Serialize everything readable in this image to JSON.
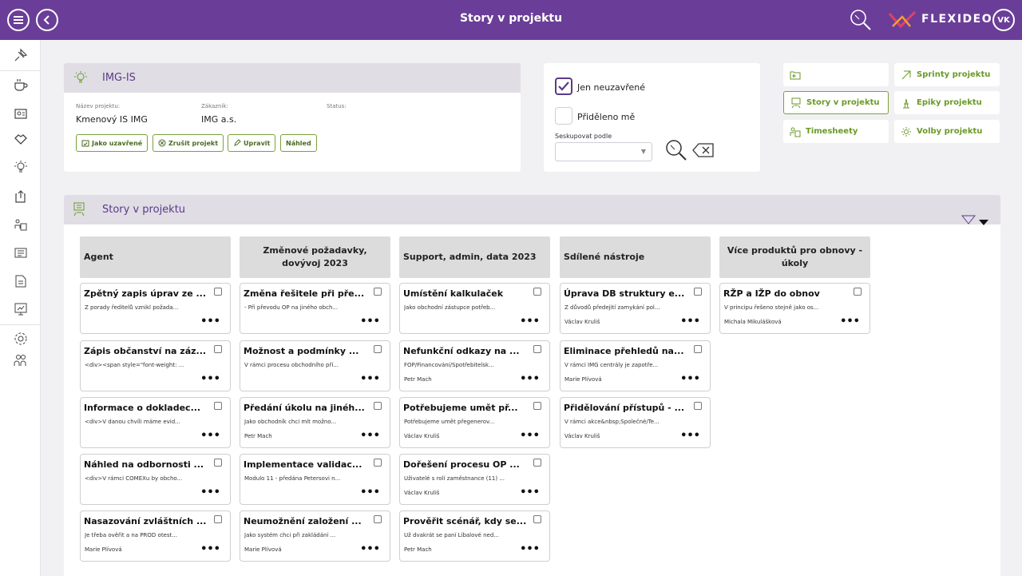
{
  "app": {
    "title": "Story v projektu",
    "brand": "FLEXIDEO",
    "user_initials": "VK"
  },
  "project": {
    "name": "IMG-IS",
    "fields": [
      {
        "label": "Název projektu:",
        "value": "Kmenový IS IMG"
      },
      {
        "label": "Zákazník:",
        "value": "IMG a.s."
      },
      {
        "label": "Status:",
        "value": ""
      }
    ],
    "actions": [
      "Jako uzavřené",
      "Zrušit projekt",
      "Upravit",
      "Náhled"
    ]
  },
  "filters": {
    "only_open": {
      "label": "Jen neuzavřené",
      "checked": true
    },
    "assigned_to_me": {
      "label": "Přiděleno mě",
      "checked": false
    },
    "group_by": {
      "label": "Seskupovat podle",
      "value": ""
    }
  },
  "nav": {
    "sprints": "Sprinty projektu",
    "stories": "Story v projektu",
    "epics": "Epiky projektu",
    "timesheets": "Timesheety",
    "options": "Volby projektu"
  },
  "board": {
    "title": "Story v projektu",
    "columns": [
      {
        "title": "Agent",
        "cards": [
          {
            "title": "Zpětný zapis úprav ze ...",
            "desc": "Z porady ředitelů vznikl požada...",
            "assignee": ""
          },
          {
            "title": "Zápis občanství na záz...",
            "desc": "<div><span style=\"font-weight: ...",
            "assignee": ""
          },
          {
            "title": "Informace o dokladec...",
            "desc": "<div>V danou chvíli máme evid...",
            "assignee": ""
          },
          {
            "title": "Náhled na odbornosti ...",
            "desc": "<div>V rámci COMEXu by obcho...",
            "assignee": ""
          },
          {
            "title": "Nasazování zvláštních ...",
            "desc": "Je třeba ověřit a na PROD otest...",
            "assignee": "Marie Plívová"
          }
        ]
      },
      {
        "title": "Změnové požadavky, dovývoj 2023",
        "cards": [
          {
            "title": "Změna řešitele při pře...",
            "desc": "- Při převodu OP na jiného obch...",
            "assignee": ""
          },
          {
            "title": "Možnost a podmínky ...",
            "desc": "V rámci procesu obchodního pří...",
            "assignee": ""
          },
          {
            "title": "Předání úkolu na jinéh...",
            "desc": "Jako obchodník chci mít možno...",
            "assignee": "Petr Mach"
          },
          {
            "title": "Implementace validac...",
            "desc": "Modulo 11 - předána Petersovi n...",
            "assignee": ""
          },
          {
            "title": "Neumožnění založení ...",
            "desc": "Jako systém chci při zakládání ...",
            "assignee": "Marie Plívová"
          }
        ]
      },
      {
        "title": "Support, admin, data 2023",
        "cards": [
          {
            "title": "Umístění kalkulaček",
            "desc": "Jako obchodní zástupce potřeb...",
            "assignee": ""
          },
          {
            "title": "Nefunkční odkazy na ...",
            "desc": "FOP/Financování/Spotřebitelsk...",
            "assignee": "Petr Mach"
          },
          {
            "title": "Potřebujeme umět př...",
            "desc": "Potřebujeme umět přegenerov...",
            "assignee": "Václav Kruliš"
          },
          {
            "title": "Dořešení procesu OP ...",
            "desc": "Uživatelé s rolí zaměstnance (11) ...",
            "assignee": "Václav Kruliš"
          },
          {
            "title": "Prověřit scénář, kdy se...",
            "desc": "Už dvakrát se paní Líbalové ned...",
            "assignee": "Petr Mach"
          }
        ]
      },
      {
        "title": "Sdílené nástroje",
        "cards": [
          {
            "title": "Úprava DB struktury e...",
            "desc": "Z důvodů předejití zamykání pol...",
            "assignee": "Václav Kruliš"
          },
          {
            "title": "Eliminace přehledů na...",
            "desc": "V rámci IMG centrály je zapotře...",
            "assignee": "Marie Plívová"
          },
          {
            "title": "Přidělování přístupů - ...",
            "desc": "V rámci akce&nbsp;Společné/Te...",
            "assignee": "Václav Kruliš"
          }
        ]
      },
      {
        "title": "Více produktů pro obnovy - úkoly",
        "cards": [
          {
            "title": "RŽP a IŽP do obnov",
            "desc": "V principu řešeno stejně jako os...",
            "assignee": "Michala Mikulášková"
          }
        ]
      }
    ]
  },
  "colors": {
    "topbar": "#6a3e98",
    "accent_green": "#7aa23a",
    "panel_head": "#e0dde5"
  }
}
